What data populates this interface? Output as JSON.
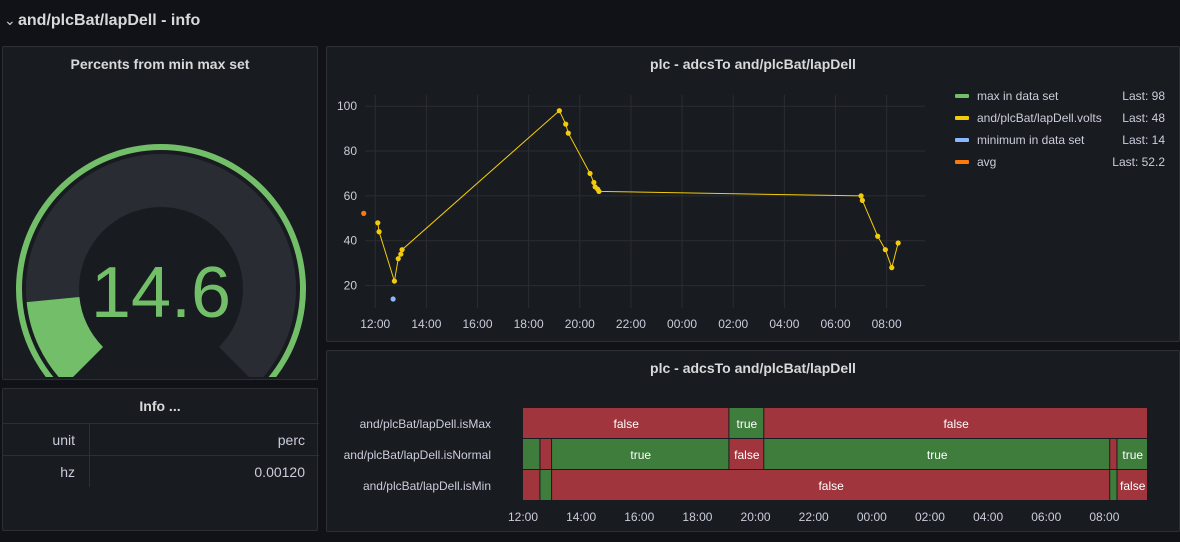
{
  "row": {
    "title": "and/plcBat/lapDell - info",
    "chevron_icon": "chevron-down-icon"
  },
  "gauge_panel": {
    "title": "Percents from min max set",
    "value": "14.6",
    "value_fraction": 0.146,
    "colors": {
      "track": "#2a2c33",
      "fill": "#73bf69",
      "low_threshold": "#8f3bb8",
      "high_threshold": "#ff9830"
    }
  },
  "info_panel": {
    "title": "Info ...",
    "rows": [
      {
        "key": "unit",
        "value": "perc"
      },
      {
        "key": "hz",
        "value": "0.00120"
      }
    ]
  },
  "timeseries_panel": {
    "title": "plc - adcsTo and/plcBat/lapDell",
    "legend": [
      {
        "name": "max in data set",
        "last": "Last: 98",
        "color": "#73bf69"
      },
      {
        "name": "and/plcBat/lapDell.volts",
        "last": "Last: 48",
        "color": "#f2cc0c"
      },
      {
        "name": "minimum in data set",
        "last": "Last: 14",
        "color": "#8ab8ff"
      },
      {
        "name": "avg",
        "last": "Last: 52.2",
        "color": "#ff780a"
      }
    ]
  },
  "state_panel": {
    "title": "plc - adcsTo and/plcBat/lapDell",
    "x_ticks": [
      "12:00",
      "14:00",
      "16:00",
      "18:00",
      "20:00",
      "22:00",
      "00:00",
      "02:00",
      "04:00",
      "06:00",
      "08:00"
    ],
    "colors": {
      "true": "#3e7d3c",
      "false": "#a1353d"
    },
    "rows": [
      {
        "label": "and/plcBat/lapDell.isMax",
        "segments": [
          {
            "start": 12.0,
            "end": 19.1,
            "state": "false",
            "text": "false"
          },
          {
            "start": 19.1,
            "end": 20.3,
            "state": "true",
            "text": "true"
          },
          {
            "start": 20.3,
            "end": 33.5,
            "state": "false",
            "text": "false"
          }
        ]
      },
      {
        "label": "and/plcBat/lapDell.isNormal",
        "segments": [
          {
            "start": 12.0,
            "end": 12.6,
            "state": "true",
            "text": ""
          },
          {
            "start": 12.6,
            "end": 13.0,
            "state": "false",
            "text": ""
          },
          {
            "start": 13.0,
            "end": 19.1,
            "state": "true",
            "text": "true"
          },
          {
            "start": 19.1,
            "end": 20.3,
            "state": "false",
            "text": "false"
          },
          {
            "start": 20.3,
            "end": 32.2,
            "state": "true",
            "text": "true"
          },
          {
            "start": 32.2,
            "end": 32.45,
            "state": "false",
            "text": ""
          },
          {
            "start": 32.45,
            "end": 33.5,
            "state": "true",
            "text": "true"
          }
        ]
      },
      {
        "label": "and/plcBat/lapDell.isMin",
        "segments": [
          {
            "start": 12.0,
            "end": 12.6,
            "state": "false",
            "text": ""
          },
          {
            "start": 12.6,
            "end": 13.0,
            "state": "true",
            "text": ""
          },
          {
            "start": 13.0,
            "end": 32.2,
            "state": "false",
            "text": "false"
          },
          {
            "start": 32.2,
            "end": 32.45,
            "state": "true",
            "text": ""
          },
          {
            "start": 32.45,
            "end": 33.5,
            "state": "false",
            "text": "false"
          }
        ]
      }
    ]
  },
  "chart_data": {
    "type": "line",
    "title": "plc - adcsTo and/plcBat/lapDell",
    "x_unit": "hours (12 = 12:00, 24 = 00:00, 32 = 08:00 next day)",
    "xlim": [
      11.6,
      33.5
    ],
    "ylim": [
      10,
      105
    ],
    "x_ticks": [
      "12:00",
      "14:00",
      "16:00",
      "18:00",
      "20:00",
      "22:00",
      "00:00",
      "02:00",
      "04:00",
      "06:00",
      "08:00"
    ],
    "y_ticks": [
      20,
      40,
      60,
      80,
      100
    ],
    "grid": true,
    "legend_placement": "right",
    "series": [
      {
        "name": "and/plcBat/lapDell.volts",
        "color": "#f2cc0c",
        "x": [
          12.1,
          12.15,
          12.75,
          12.9,
          13.0,
          13.05,
          19.2,
          19.45,
          19.55,
          20.4,
          20.55,
          20.6,
          20.7,
          20.75,
          31.0,
          31.05,
          31.65,
          31.95,
          32.2,
          32.45
        ],
        "y": [
          48,
          44,
          22,
          32,
          34,
          36,
          98,
          92,
          88,
          70,
          66,
          64,
          63,
          62,
          60,
          58,
          42,
          36,
          28,
          39
        ]
      },
      {
        "name": "minimum in data set",
        "color": "#8ab8ff",
        "x": [
          12.7
        ],
        "y": [
          14
        ]
      },
      {
        "name": "avg",
        "color": "#ff780a",
        "x": [
          11.55
        ],
        "y": [
          52.2
        ]
      },
      {
        "name": "max in data set",
        "color": "#73bf69",
        "x": [],
        "y": []
      }
    ]
  }
}
